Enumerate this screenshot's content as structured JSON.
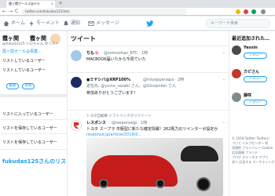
{
  "browser": {
    "tab_title": "霞ヶ関ガールズ@キモ",
    "tab_close": "×",
    "new_tab": "+",
    "url": "twitter.com/fukudas125/lists",
    "back": "←",
    "forward": "→",
    "reload": "C"
  },
  "topnav": {
    "home": "ホーム",
    "moments": "モーメント",
    "notifications": "通知",
    "messages": "メッセージ",
    "search_placeholder": "キーワード検索",
    "brand_color": "#1da1f2"
  },
  "profile": {
    "name_left": "霞ヶ関",
    "name_right": "霞ヶ関",
    "subtitle": "@fukuda125  シロちゃん のリスト",
    "line1": "霞ヶ関ガール@事業…",
    "line2": "リストしているユーザー",
    "line3": "リストしているユーザー",
    "btn_edit": "編集",
    "btn_delete": "削除"
  },
  "lists": {
    "item1": "リストに入っているユーザー",
    "item2": "リストを保存しているユーザー",
    "item3": "リストを保存しているユーザー",
    "title": "fukudas125さんのリスト"
  },
  "timeline": {
    "header": "ツイート",
    "tweet1": {
      "author": "ちも🌸",
      "handle": "@somoohan_BTC · 1時",
      "text": "MACBOOK届いたから今見ていた"
    },
    "tweet2": {
      "author": "●ミヤシバ@XRP100%",
      "handle": "@miyappanapa · 2時",
      "reply_to": "返信先: @yuino_sasaki さん、@Ginopnker さん",
      "text": "参加ありがとうございます！"
    },
    "tweet3": {
      "retweet_note": "トヨタ自動車 ソフトバンクがリツイート",
      "author": "レスポンス",
      "handle": "@responsejp · 1時",
      "text": "トヨタ スープラ 市販型に新たな確定情報！262馬力のツインターボ設定か",
      "link": "response.jp/article/2018/0…"
    }
  },
  "sidebar_right": {
    "header": "最近追加された…",
    "user1": {
      "name": "Yassin",
      "btn": "フォロー"
    },
    "user2": {
      "name": "カピさん",
      "btn": "フォロー"
    },
    "user3": {
      "name": "藤咲",
      "btn": "フォロー"
    },
    "footer1": "© 2018 Twitter  Twitterに",
    "footer2": "ついて  ヘルプセンター  利",
    "footer3": "用規約  プライバシー  Cookie",
    "footer4": "広告情報  ブランド",
    "footer5": "ブログ  ステータス  アプリ",
    "footer6": "求人  広告する  マーケティング"
  }
}
